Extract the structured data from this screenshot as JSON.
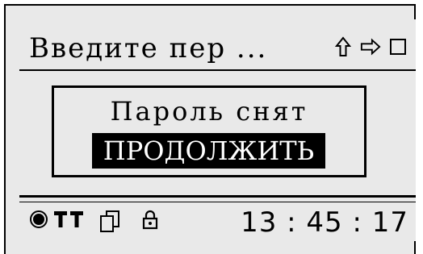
{
  "header": {
    "title": "Введите пер ...",
    "icons": [
      "shift-up-icon",
      "arrow-right-icon",
      "square-icon"
    ]
  },
  "dialog": {
    "message": "Пароль снят",
    "button_label": "ПРОДОЛЖИТЬ"
  },
  "status_bar": {
    "icons": [
      "record-icon",
      "signal-icon",
      "document-icon",
      "lock-icon"
    ],
    "time": "13 : 45 : 17"
  }
}
